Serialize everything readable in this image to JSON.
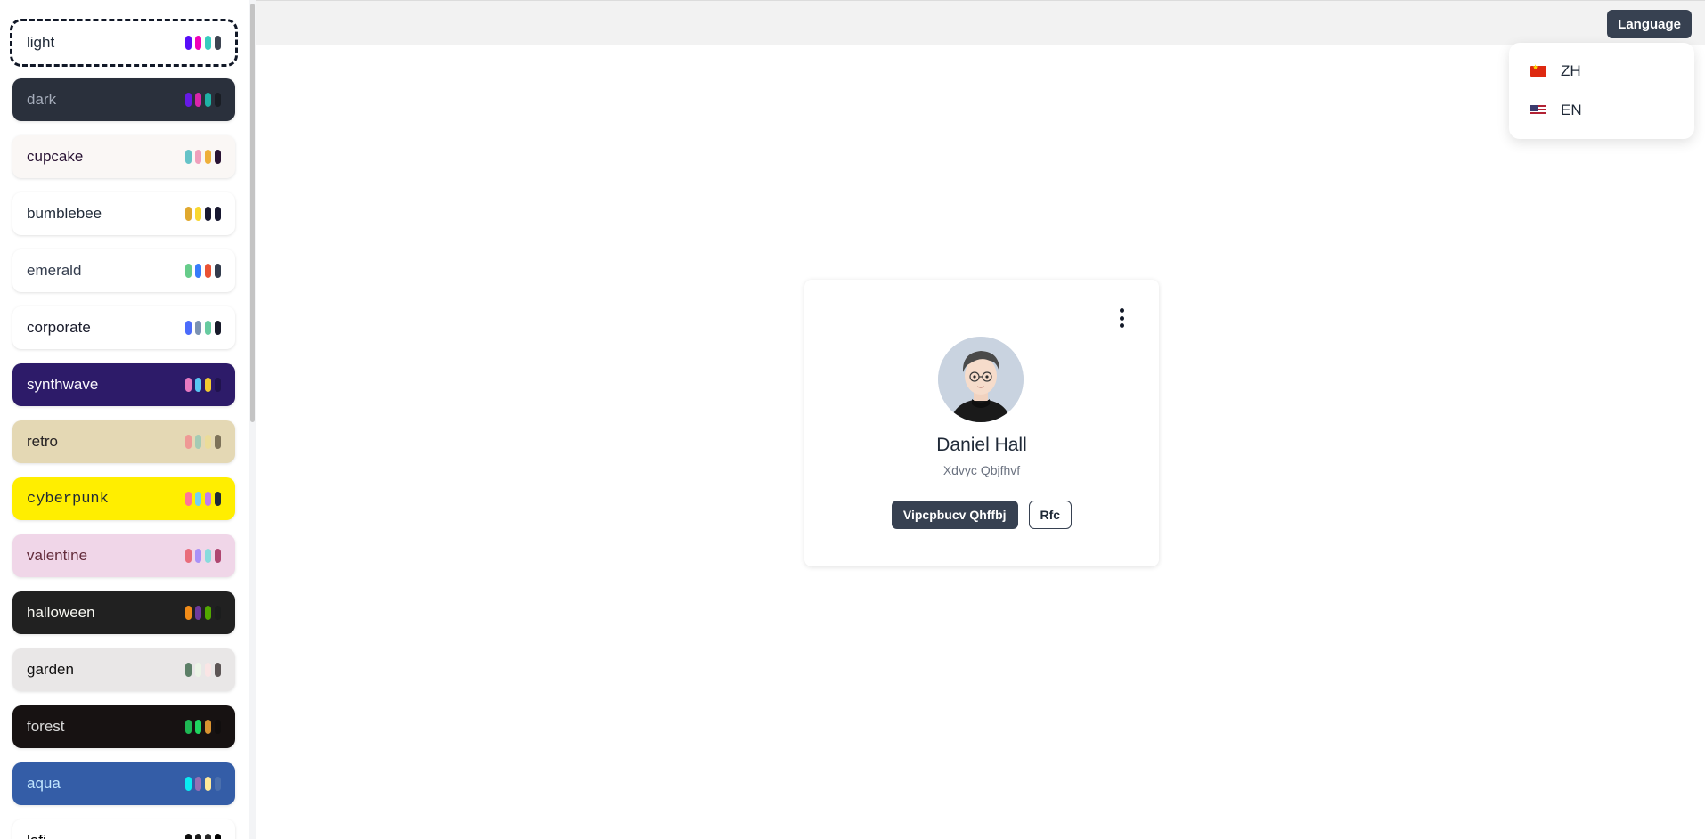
{
  "themes": [
    {
      "name": "light",
      "bg": "#ffffff",
      "fg": "#1f2937",
      "swatches": [
        "#570df8",
        "#f000b8",
        "#37cdbe",
        "#3d4451"
      ]
    },
    {
      "name": "dark",
      "bg": "#2a303c",
      "fg": "#a6adbb",
      "swatches": [
        "#661ae6",
        "#d926aa",
        "#1fb2a5",
        "#191d24"
      ]
    },
    {
      "name": "cupcake",
      "bg": "#faf7f5",
      "fg": "#291334",
      "swatches": [
        "#65c3c8",
        "#ef9fbc",
        "#eeaf3a",
        "#291334"
      ]
    },
    {
      "name": "bumblebee",
      "bg": "#ffffff",
      "fg": "#1f2937",
      "swatches": [
        "#e0a82e",
        "#f9d72f",
        "#181830",
        "#181830"
      ]
    },
    {
      "name": "emerald",
      "bg": "#ffffff",
      "fg": "#333c4d",
      "swatches": [
        "#66cc8a",
        "#377cfb",
        "#ea5234",
        "#333c4d"
      ]
    },
    {
      "name": "corporate",
      "bg": "#ffffff",
      "fg": "#181a2a",
      "swatches": [
        "#4b6bfb",
        "#7b92b2",
        "#67cba0",
        "#181a2a"
      ]
    },
    {
      "name": "synthwave",
      "bg": "#2d1b69",
      "fg": "#f9f7fd",
      "swatches": [
        "#e779c1",
        "#58c7f3",
        "#f3cc30",
        "#20134e"
      ]
    },
    {
      "name": "retro",
      "bg": "#e4d8b4",
      "fg": "#282425",
      "swatches": [
        "#ef9995",
        "#a4cbb4",
        "#ebdc99",
        "#7d7259"
      ]
    },
    {
      "name": "cyberpunk",
      "bg": "#ffee00",
      "fg": "#1f2937",
      "swatches": [
        "#ff7598",
        "#75d1f0",
        "#c07eec",
        "#1f2937"
      ]
    },
    {
      "name": "valentine",
      "bg": "#f0d6e8",
      "fg": "#632c3b",
      "swatches": [
        "#e96d7b",
        "#a991f7",
        "#88dbdd",
        "#af4670"
      ]
    },
    {
      "name": "halloween",
      "bg": "#212121",
      "fg": "#f8f8f2",
      "swatches": [
        "#f28c18",
        "#6d3a9c",
        "#51a800",
        "#1b1d1d"
      ]
    },
    {
      "name": "garden",
      "bg": "#e9e7e7",
      "fg": "#100f0f",
      "swatches": [
        "#5c7f67",
        "#ecf4e7",
        "#fae5e5",
        "#5d5656"
      ]
    },
    {
      "name": "forest",
      "bg": "#171212",
      "fg": "#d9d9d9",
      "swatches": [
        "#1eb854",
        "#1fd65f",
        "#d99330",
        "#110e0e"
      ]
    },
    {
      "name": "aqua",
      "bg": "#345da7",
      "fg": "#c1e6ff",
      "swatches": [
        "#09ecf3",
        "#966fb3",
        "#ffe999",
        "#4a6fad"
      ]
    },
    {
      "name": "lofi",
      "bg": "#ffffff",
      "fg": "#000000",
      "swatches": [
        "#0d0d0d",
        "#1a1a1a",
        "#262626",
        "#000000"
      ]
    }
  ],
  "header": {
    "language_button": "Language"
  },
  "language_menu": {
    "options": [
      "ZH",
      "EN"
    ]
  },
  "profile": {
    "name": "Daniel Hall",
    "subtitle": "Xdvyc Qbjfhvf",
    "primary_action": "Vipcpbucv Qhffbj",
    "secondary_action": "Rfc"
  }
}
